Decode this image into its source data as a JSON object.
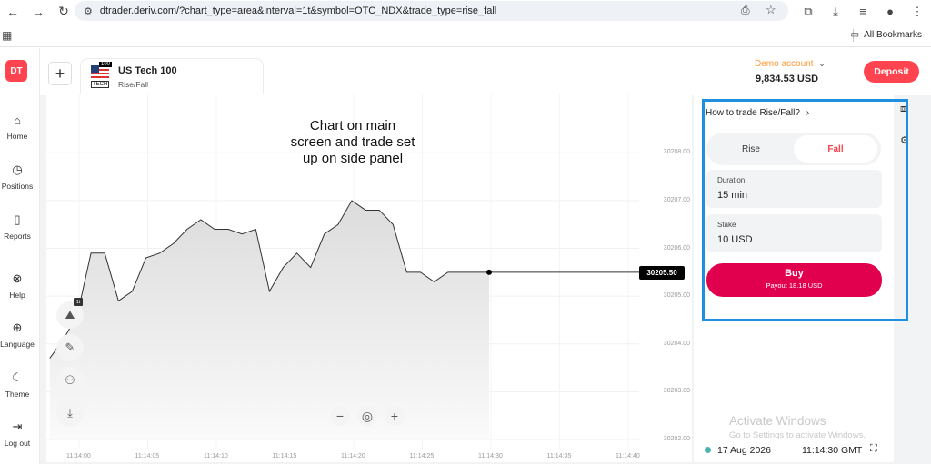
{
  "browser": {
    "url": "dtrader.deriv.com/?chart_type=area&interval=1t&symbol=OTC_NDX&trade_type=rise_fall",
    "all_bookmarks": "All Bookmarks"
  },
  "sidebar": {
    "logo": "DT",
    "items": [
      {
        "label": "Home",
        "icon": "home-icon"
      },
      {
        "label": "Positions",
        "icon": "clock-icon"
      },
      {
        "label": "Reports",
        "icon": "document-icon"
      },
      {
        "label": "Help",
        "icon": "lifebuoy-icon"
      },
      {
        "label": "Language",
        "icon": "globe-icon"
      },
      {
        "label": "Theme",
        "icon": "moon-icon"
      },
      {
        "label": "Log out",
        "icon": "logout-icon"
      }
    ]
  },
  "header": {
    "symbol_name": "US Tech 100",
    "symbol_sub": "Rise/Fall",
    "flag_tag": "100",
    "flag_text": "TECH",
    "demo_label": "Demo account",
    "balance": "9,834.53 USD",
    "deposit": "Deposit"
  },
  "chart": {
    "annotation": "Chart on main screen and trade set up on side panel",
    "current_price": "30205.50",
    "interval_badge": "1t",
    "y_ticks": [
      "30208.00",
      "30207.00",
      "30206.00",
      "30205.00",
      "30204.00",
      "30203.00",
      "30202.00"
    ],
    "x_ticks": [
      "11:14:00",
      "11:14:05",
      "11:14:10",
      "11:14:15",
      "11:14:20",
      "11:14:25",
      "11:14:30",
      "11:14:35",
      "11:14:40"
    ]
  },
  "chart_data": {
    "type": "area",
    "x": [
      "11:13:58",
      "11:13:59",
      "11:14:00",
      "11:14:01",
      "11:14:02",
      "11:14:03",
      "11:14:04",
      "11:14:05",
      "11:14:06",
      "11:14:07",
      "11:14:08",
      "11:14:09",
      "11:14:10",
      "11:14:11",
      "11:14:12",
      "11:14:13",
      "11:14:14",
      "11:14:15",
      "11:14:16",
      "11:14:17",
      "11:14:18",
      "11:14:19",
      "11:14:20",
      "11:14:21",
      "11:14:22",
      "11:14:23",
      "11:14:24",
      "11:14:25",
      "11:14:26",
      "11:14:27",
      "11:14:28",
      "11:14:29",
      "11:14:30"
    ],
    "y": [
      30203.7,
      30204.1,
      30204.6,
      30205.9,
      30205.9,
      30204.9,
      30205.1,
      30205.8,
      30205.9,
      30206.1,
      30206.4,
      30206.6,
      30206.4,
      30206.4,
      30206.3,
      30206.4,
      30205.1,
      30205.6,
      30205.9,
      30205.6,
      30206.3,
      30206.5,
      30207.0,
      30206.8,
      30206.8,
      30206.5,
      30205.5,
      30205.5,
      30205.3,
      30205.5,
      30205.5,
      30205.5,
      30205.5
    ],
    "ylim": [
      30202.0,
      30208.5
    ],
    "y_ticks": [
      30202,
      30203,
      30204,
      30205,
      30206,
      30207,
      30208
    ],
    "current": 30205.5,
    "grid": true,
    "title": "",
    "xlabel": "",
    "ylabel": ""
  },
  "trade": {
    "howto": "How to trade Rise/Fall?",
    "rise": "Rise",
    "fall": "Fall",
    "duration_label": "Duration",
    "duration_value": "15 min",
    "stake_label": "Stake",
    "stake_value": "10 USD",
    "buy_label": "Buy",
    "payout": "Payout  18.18 USD",
    "activate": "Activate Windows",
    "activate_sub": "Go to Settings to activate Windows.",
    "date": "17 Aug 2026",
    "time": "11:14:30 GMT"
  },
  "colors": {
    "brand": "#ff444f",
    "buy": "#e0004d",
    "fall_text": "#ff444f",
    "highlight_box": "#1f8fe0"
  }
}
